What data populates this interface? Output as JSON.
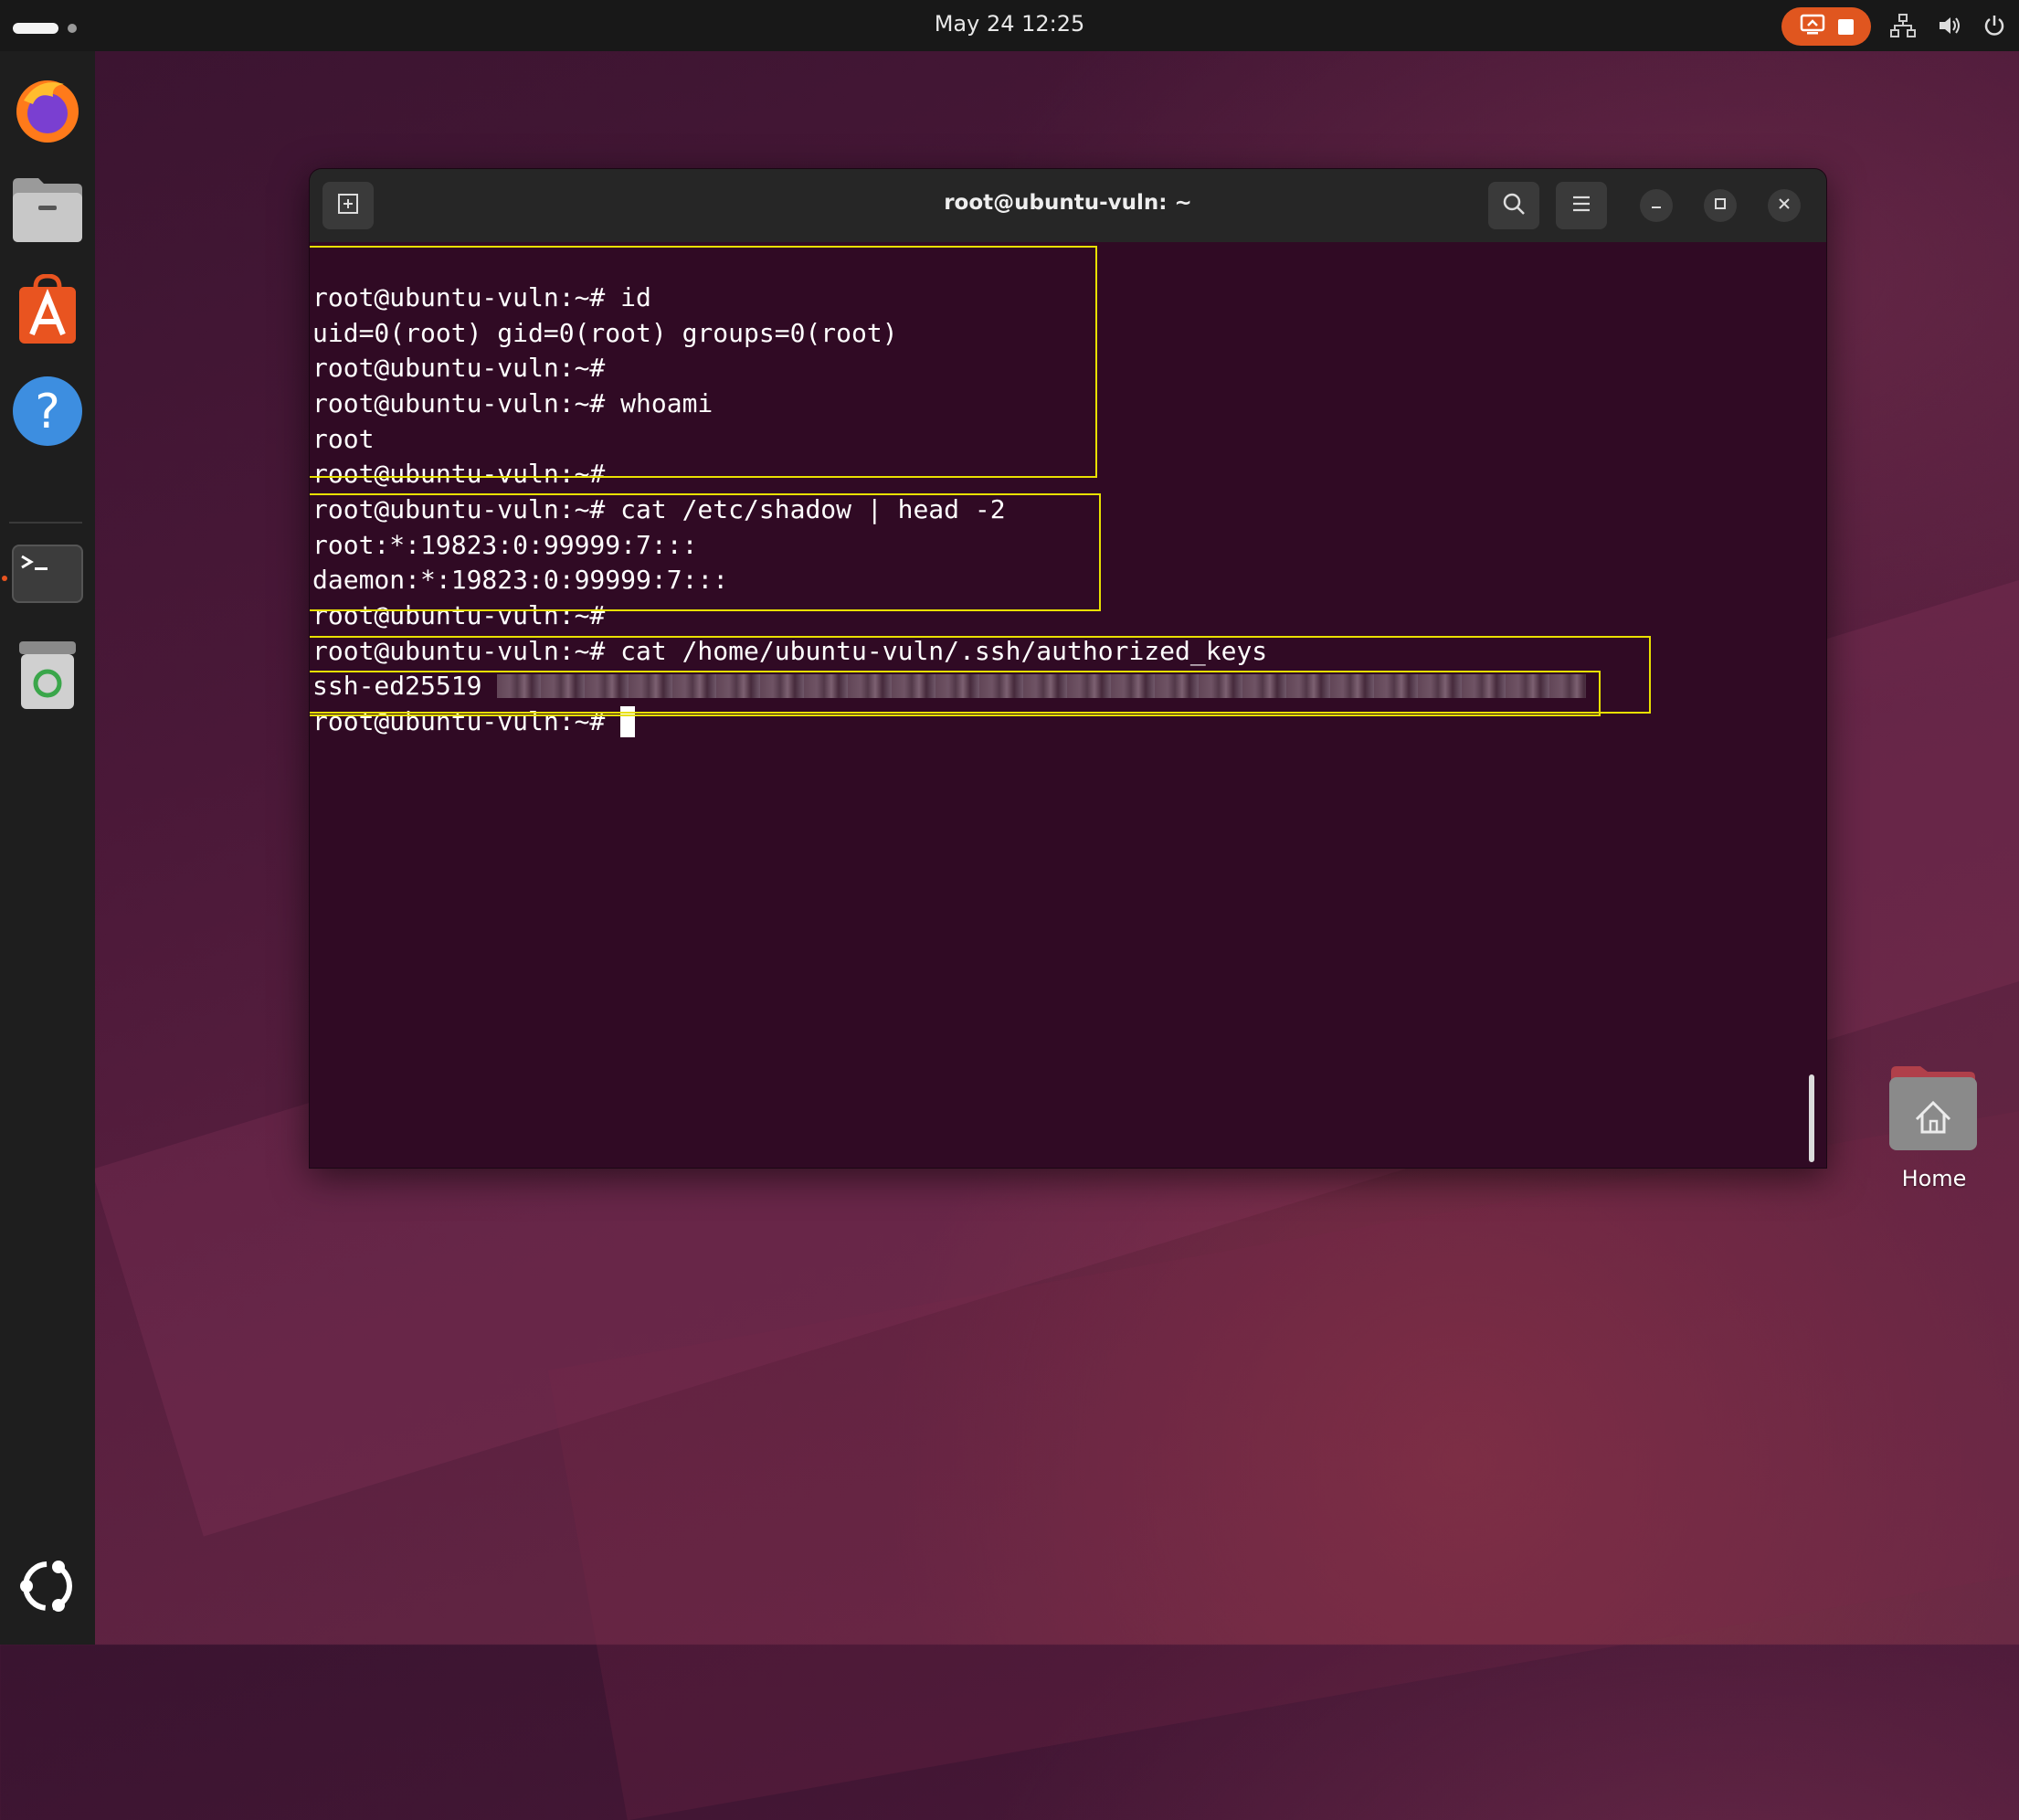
{
  "topbar": {
    "clock": "May 24  12:25"
  },
  "dock": {
    "apps": [
      {
        "name": "firefox",
        "icon": "firefox-icon"
      },
      {
        "name": "files",
        "icon": "files-icon"
      },
      {
        "name": "app-center",
        "icon": "app-center-icon"
      },
      {
        "name": "help",
        "icon": "help-icon"
      },
      {
        "name": "terminal",
        "icon": "terminal-icon"
      },
      {
        "name": "trash",
        "icon": "trash-icon"
      },
      {
        "name": "show-apps",
        "icon": "ubuntu-logo-icon"
      }
    ]
  },
  "terminal": {
    "title": "root@ubuntu-vuln: ~",
    "lines": [
      "root@ubuntu-vuln:~# id",
      "uid=0(root) gid=0(root) groups=0(root)",
      "root@ubuntu-vuln:~#",
      "root@ubuntu-vuln:~# whoami",
      "root",
      "root@ubuntu-vuln:~#",
      "root@ubuntu-vuln:~# cat /etc/shadow | head -2",
      "root:*:19823:0:99999:7:::",
      "daemon:*:19823:0:99999:7:::",
      "root@ubuntu-vuln:~#",
      "root@ubuntu-vuln:~# cat /home/ubuntu-vuln/.ssh/authorized_keys",
      "ssh-ed25519",
      "root@ubuntu-vuln:~#"
    ]
  },
  "desktop": {
    "home_label": "Home"
  },
  "colors": {
    "terminal_bg": "#300a24",
    "highlight": "#e8e000",
    "accent": "#e95420"
  }
}
